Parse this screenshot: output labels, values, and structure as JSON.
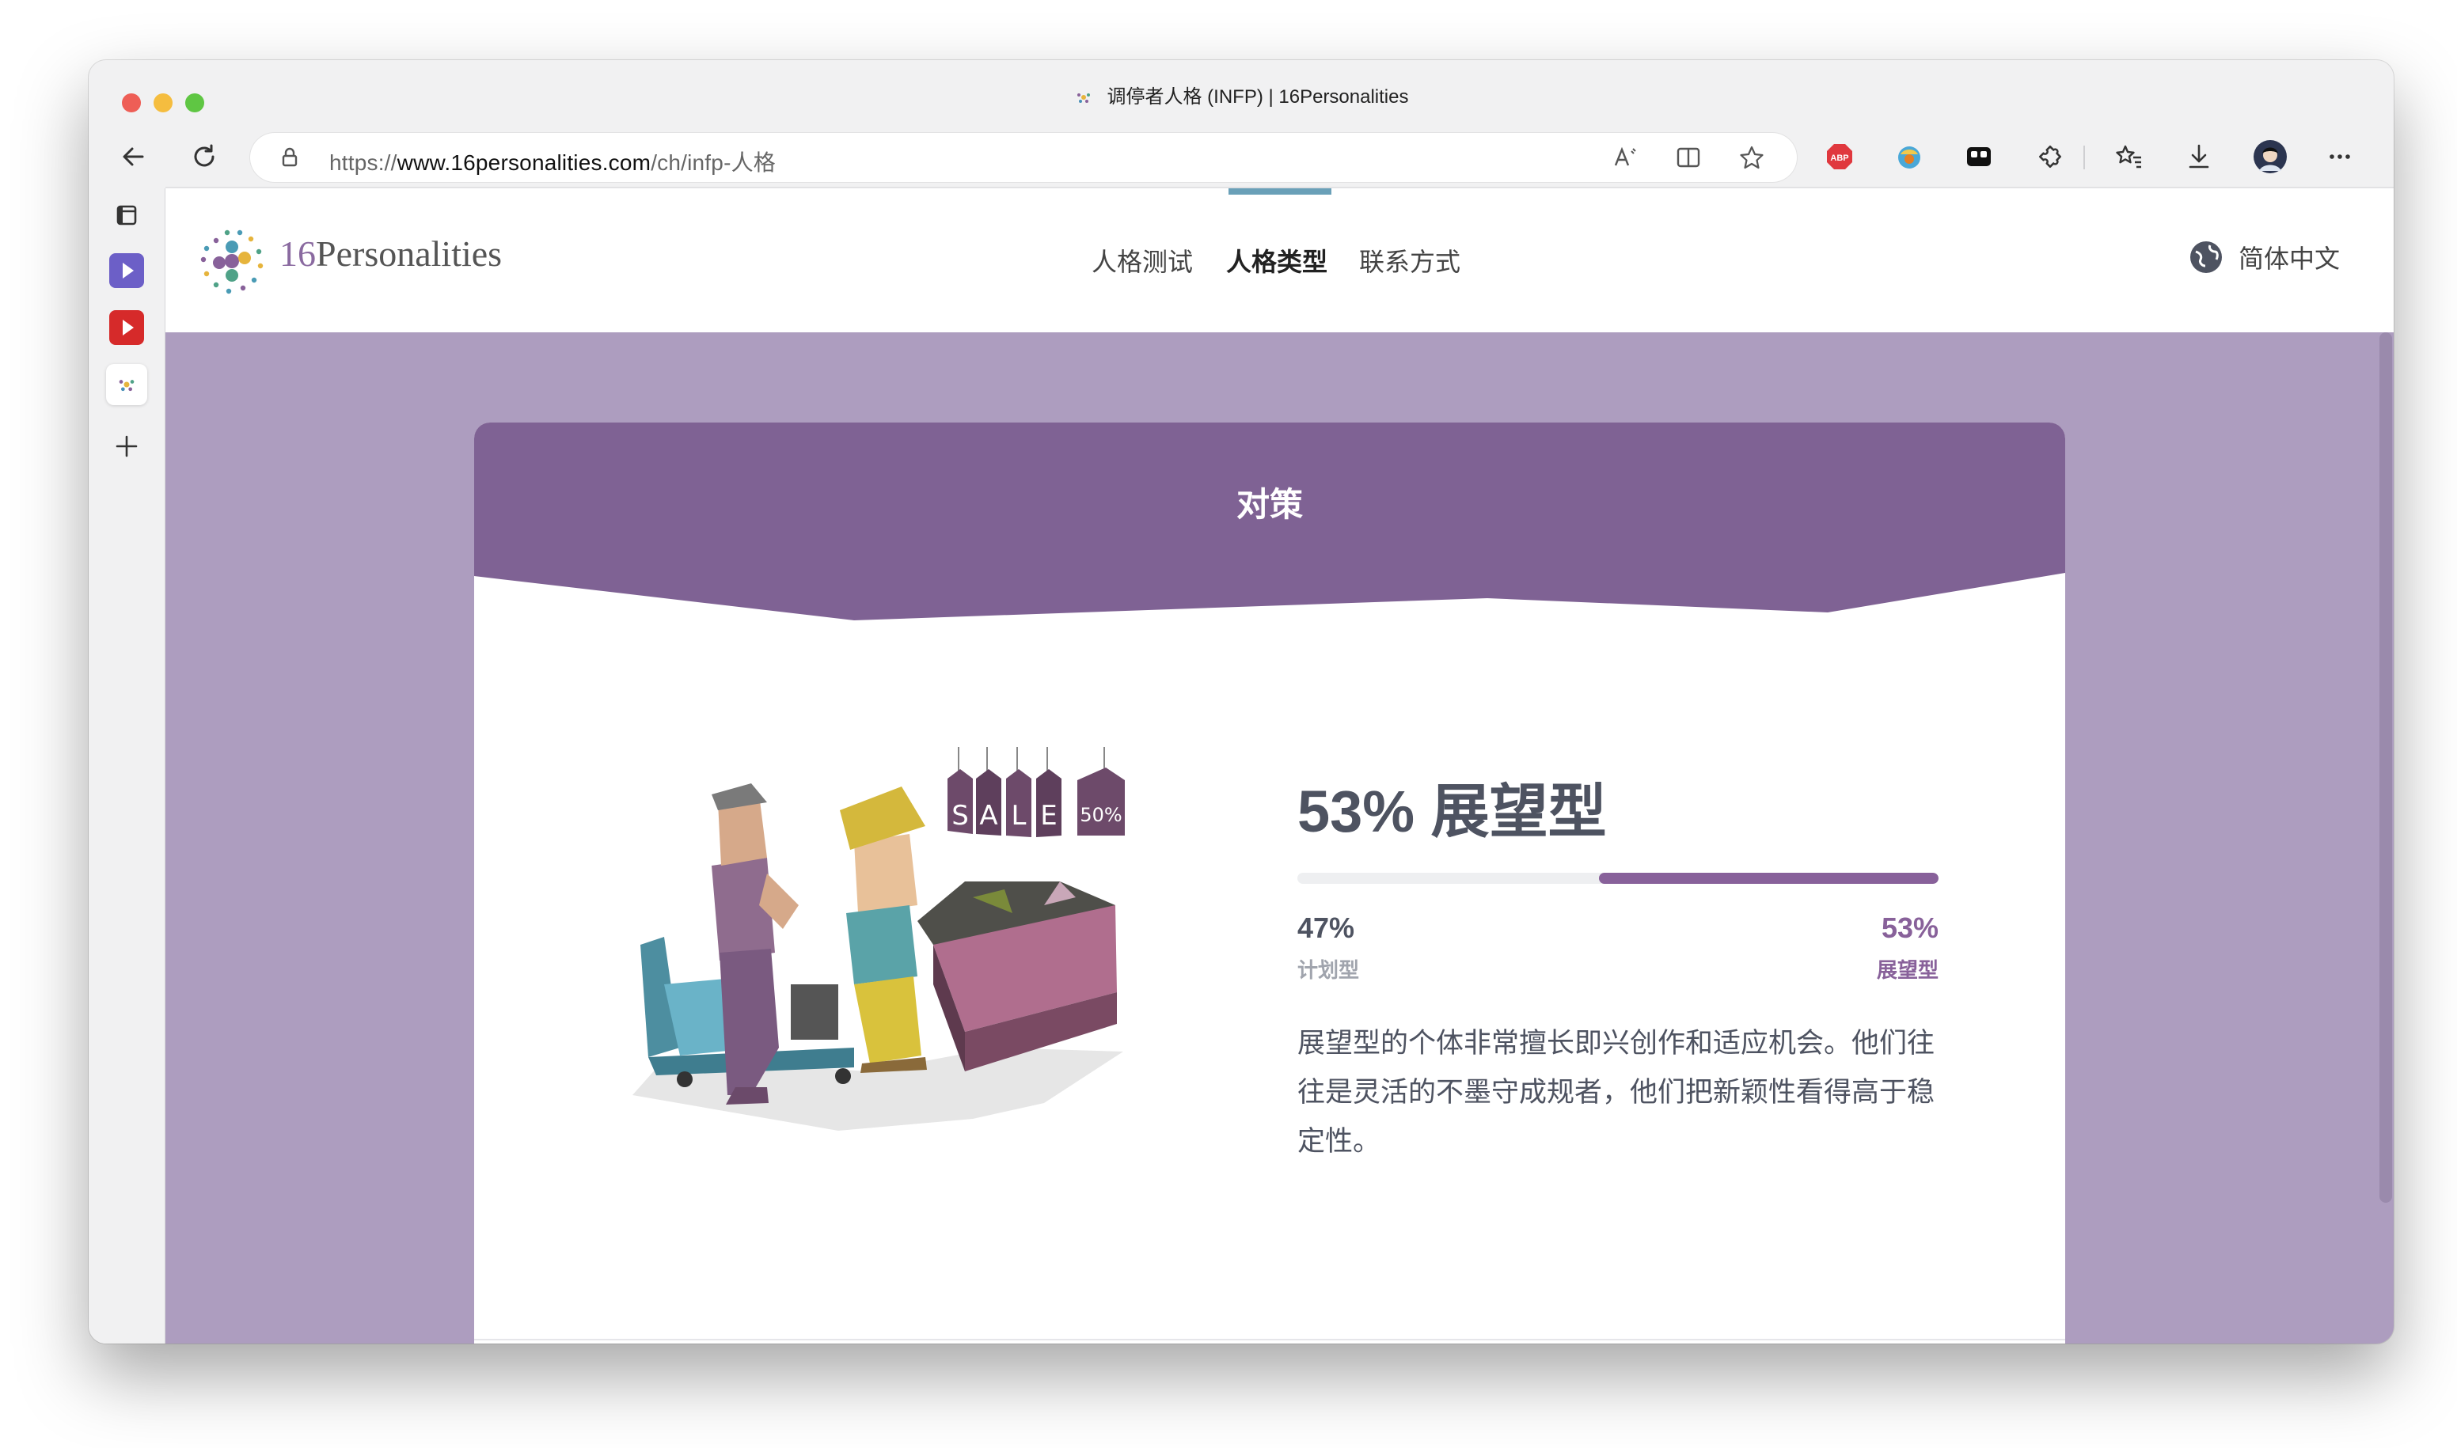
{
  "browser": {
    "tab_title": "调停者人格 (INFP) | 16Personalities",
    "url_scheme": "https://",
    "url_host": "www.16personalities.com",
    "url_path": "/ch/infp-人格",
    "icons": [
      "back-icon",
      "reload-icon",
      "lock-icon",
      "read-aloud-icon",
      "split-screen-icon",
      "favorite-star-icon",
      "adblock-icon",
      "extension-icon",
      "tab-manager-icon",
      "puzzle-icon",
      "favorites-icon",
      "download-icon",
      "profile-avatar",
      "more-icon"
    ]
  },
  "sidebar": {
    "items": [
      "tab-actions-icon",
      "purple-app-icon",
      "youtube-icon",
      "16personalities-tab-icon",
      "add-icon"
    ]
  },
  "site": {
    "logo_number": "16",
    "logo_name": "Personalities",
    "nav": [
      {
        "label": "人格测试"
      },
      {
        "label": "人格类型"
      },
      {
        "label": "联系方式"
      }
    ],
    "language": "简体中文"
  },
  "section": {
    "title": "对策",
    "trait_heading": "53% 展望型",
    "trait_percent": 53,
    "left_percent": "47%",
    "left_label": "计划型",
    "right_percent": "53%",
    "right_label": "展望型",
    "description": "展望型的个体非常擅长即兴创作和适应机会。他们往往是灵活的不墨守成规者，他们把新颖性看得高于稳定性。",
    "illustration_tags": [
      "S",
      "A",
      "L",
      "E",
      "50%"
    ]
  },
  "colors": {
    "accent_purple": "#88619a",
    "page_background": "#ad9dbf",
    "banner_purple": "#7f6294",
    "text_dark": "#4e5361",
    "teal": "#6aa0b8"
  }
}
